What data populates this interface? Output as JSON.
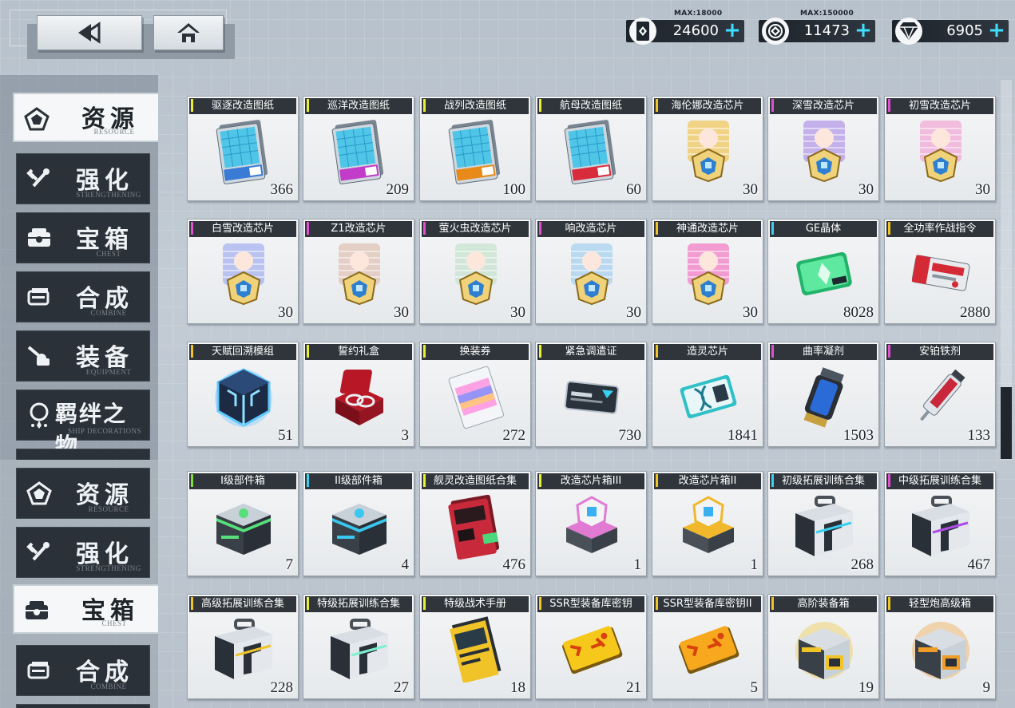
{
  "currencies": [
    {
      "icon": "oil-drum-icon",
      "max": "MAX:18000",
      "value": "24600"
    },
    {
      "icon": "gold-coin-icon",
      "max": "MAX:150000",
      "value": "11473"
    },
    {
      "icon": "diamond-gem-icon",
      "max": "",
      "value": "6905"
    }
  ],
  "plus_label": "+",
  "sidebar_top": [
    {
      "cn": "资源",
      "en": "RESOURCE",
      "active": true
    },
    {
      "cn": "强化",
      "en": "STRENGTHENING"
    },
    {
      "cn": "宝箱",
      "en": "CHEST"
    },
    {
      "cn": "合成",
      "en": "COMBINE"
    },
    {
      "cn": "装备",
      "en": "EQUIPMENT"
    },
    {
      "cn": "羁绊之物",
      "en": "SHIP DECORATIONS"
    }
  ],
  "sidebar_bottom": [
    {
      "cn": "资源",
      "en": "RESOURCE"
    },
    {
      "cn": "强化",
      "en": "STRENGTHENING"
    },
    {
      "cn": "宝箱",
      "en": "CHEST",
      "active": true
    },
    {
      "cn": "合成",
      "en": "COMBINE"
    }
  ],
  "items": [
    [
      {
        "name": "驱逐改造图纸",
        "count": "366",
        "rarity": "#e9f034",
        "art": "blueprint",
        "accent": "#3a7bd5"
      },
      {
        "name": "巡洋改造图纸",
        "count": "209",
        "rarity": "#e9f034",
        "art": "blueprint",
        "accent": "#c23cc9"
      },
      {
        "name": "战列改造图纸",
        "count": "100",
        "rarity": "#e9f034",
        "art": "blueprint",
        "accent": "#e88a1a"
      },
      {
        "name": "航母改造图纸",
        "count": "60",
        "rarity": "#e9f034",
        "art": "blueprint",
        "accent": "#d82c3c"
      },
      {
        "name": "海伦娜改造芯片",
        "count": "30",
        "rarity": "#f0c428",
        "art": "chip",
        "accent": "#f0c860"
      },
      {
        "name": "深雪改造芯片",
        "count": "30",
        "rarity": "#e04fd0",
        "art": "chip",
        "accent": "#b59be8"
      },
      {
        "name": "初雪改造芯片",
        "count": "30",
        "rarity": "#e04fd0",
        "art": "chip",
        "accent": "#f2a9d6"
      }
    ],
    [
      {
        "name": "白雪改造芯片",
        "count": "30",
        "rarity": "#e04fd0",
        "art": "chip",
        "accent": "#a7b3f0"
      },
      {
        "name": "Z1改造芯片",
        "count": "30",
        "rarity": "#e04fd0",
        "art": "chip",
        "accent": "#e0c3b5"
      },
      {
        "name": "萤火虫改造芯片",
        "count": "30",
        "rarity": "#e04fd0",
        "art": "chip",
        "accent": "#c7e3cf"
      },
      {
        "name": "响改造芯片",
        "count": "30",
        "rarity": "#e04fd0",
        "art": "chip",
        "accent": "#a8d2f0"
      },
      {
        "name": "神通改造芯片",
        "count": "30",
        "rarity": "#f0c428",
        "art": "chip",
        "accent": "#f37fc7"
      },
      {
        "name": "GE晶体",
        "count": "8028",
        "rarity": "#3ad0f0",
        "art": "crystal",
        "accent": "#22b36a"
      },
      {
        "name": "全功率作战指令",
        "count": "2880",
        "rarity": "#f0c428",
        "art": "ticket",
        "accent": "#d32a36"
      }
    ],
    [
      {
        "name": "天赋回溯模组",
        "count": "51",
        "rarity": "#f0c428",
        "art": "cube",
        "accent": "#35a8ff"
      },
      {
        "name": "誓约礼盒",
        "count": "3",
        "rarity": "#e9f034",
        "art": "ring",
        "accent": "#b81826"
      },
      {
        "name": "换装券",
        "count": "272",
        "rarity": "#e9f034",
        "art": "dress",
        "accent": "#ff8fe0"
      },
      {
        "name": "紧急调遣证",
        "count": "730",
        "rarity": "#e9f034",
        "art": "card",
        "accent": "#3e4a58"
      },
      {
        "name": "造灵芯片",
        "count": "1841",
        "rarity": "#f0c428",
        "art": "dna",
        "accent": "#2fc0c8"
      },
      {
        "name": "曲率凝剂",
        "count": "1503",
        "rarity": "#e04fd0",
        "art": "canister",
        "accent": "#2a6bd8"
      },
      {
        "name": "安铂铁剂",
        "count": "133",
        "rarity": "#e04fd0",
        "art": "syringe",
        "accent": "#c8283a"
      }
    ],
    [
      {
        "name": "I级部件箱",
        "count": "7",
        "rarity": "#7be03a",
        "art": "box",
        "accent": "#57e07a"
      },
      {
        "name": "II级部件箱",
        "count": "4",
        "rarity": "#3ad0f0",
        "art": "box",
        "accent": "#39c9f0"
      },
      {
        "name": "舰灵改造图纸合集",
        "count": "476",
        "rarity": "#e9f034",
        "art": "folder",
        "accent": "#c92a3b"
      },
      {
        "name": "改造芯片箱III",
        "count": "1",
        "rarity": "#e9f034",
        "art": "chipbox",
        "accent": "#e07ad2"
      },
      {
        "name": "改造芯片箱II",
        "count": "1",
        "rarity": "#f0c428",
        "art": "chipbox",
        "accent": "#f0b82a"
      },
      {
        "name": "初级拓展训练合集",
        "count": "268",
        "rarity": "#3ad0f0",
        "art": "case",
        "accent": "#3ad0f0"
      },
      {
        "name": "中级拓展训练合集",
        "count": "467",
        "rarity": "#e04fd0",
        "art": "case",
        "accent": "#b04ae8"
      }
    ],
    [
      {
        "name": "高级拓展训练合集",
        "count": "228",
        "rarity": "#f0c428",
        "art": "case",
        "accent": "#f0c428"
      },
      {
        "name": "特级拓展训练合集",
        "count": "27",
        "rarity": "#e9f034",
        "art": "case",
        "accent": "#7ef0d0"
      },
      {
        "name": "特级战术手册",
        "count": "18",
        "rarity": "#e9f034",
        "art": "book",
        "accent": "#f0c428"
      },
      {
        "name": "SSR型装备库密钥",
        "count": "21",
        "rarity": "#f0c428",
        "art": "key",
        "accent": "#f7c81c"
      },
      {
        "name": "SSR型装备库密钥II",
        "count": "5",
        "rarity": "#f0c428",
        "art": "key",
        "accent": "#f7a81c"
      },
      {
        "name": "高阶装备箱",
        "count": "19",
        "rarity": "#f0c428",
        "art": "crate",
        "accent": "#f0c428"
      },
      {
        "name": "轻型炮高级箱",
        "count": "9",
        "rarity": "#f0c428",
        "art": "crate",
        "accent": "#f09c28"
      }
    ]
  ]
}
